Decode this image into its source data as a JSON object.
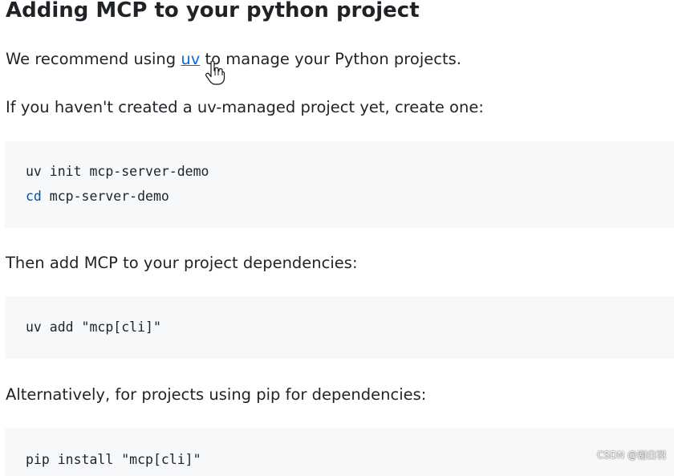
{
  "heading": "Adding MCP to your python project",
  "para1": {
    "before": "We recommend using ",
    "link": "uv",
    "after": " to manage your Python projects."
  },
  "para2": "If you haven't created a uv-managed project yet, create one:",
  "code1": {
    "line1": "uv init mcp-server-demo",
    "line2_cmd": "cd",
    "line2_rest": " mcp-server-demo"
  },
  "para3": "Then add MCP to your project dependencies:",
  "code2": {
    "line1": "uv add \"mcp[cli]\""
  },
  "para4": "Alternatively, for projects using pip for dependencies:",
  "code3": {
    "line1": "pip install \"mcp[cli]\""
  },
  "watermark": "CSDN @谢白羽",
  "colors": {
    "link": "#0969da",
    "code_bg": "#f6f8fa",
    "keyword": "#0550ae",
    "text": "#1f2328"
  },
  "icons": {
    "cursor": "hand-pointer-cursor-icon"
  }
}
